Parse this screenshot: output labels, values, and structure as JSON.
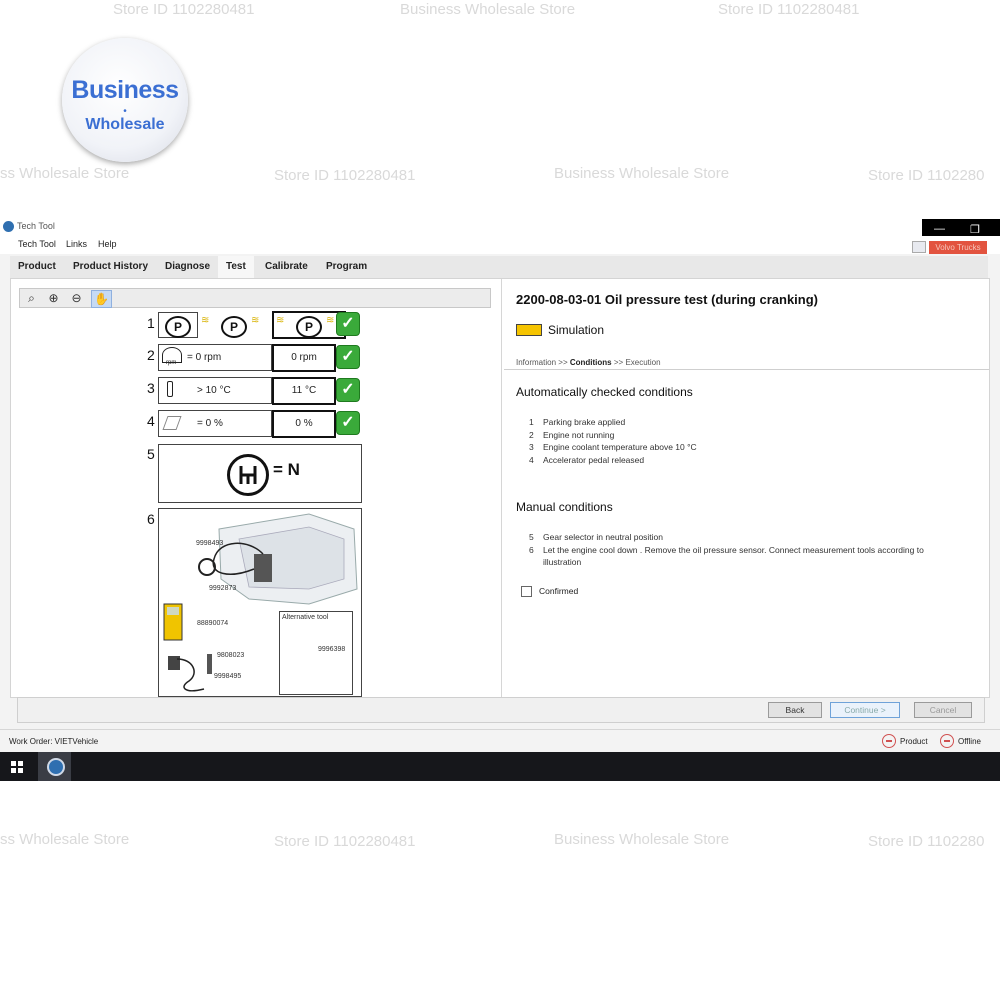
{
  "watermarks": {
    "store_id": "Store ID 1102280481",
    "store_name": "Business Wholesale Store",
    "store_name_cut": "ss Wholesale Store",
    "store_id_cut": "Store ID 1102280"
  },
  "badge": {
    "line1": "Business",
    "dot": "•",
    "line2": "Wholesale"
  },
  "window": {
    "title": "Tech Tool",
    "min_glyph": "—",
    "restore_glyph": "❐",
    "volvo_trucks": "Volvo Trucks"
  },
  "menu": [
    "Tech Tool",
    "Links",
    "Help"
  ],
  "tabs": [
    "Product",
    "Product History",
    "Diagnose",
    "Test",
    "Calibrate",
    "Program"
  ],
  "active_tab": "Test",
  "conditions_panel": {
    "rows": [
      {
        "num": "1",
        "expected": "",
        "actual": ""
      },
      {
        "num": "2",
        "expected": "= 0 rpm",
        "actual": "0 rpm",
        "unit_label": "rpm"
      },
      {
        "num": "3",
        "expected": "> 10 °C",
        "actual": "11 °C"
      },
      {
        "num": "4",
        "expected": "= 0 %",
        "actual": "0 %"
      },
      {
        "num": "5"
      },
      {
        "num": "6"
      }
    ],
    "p_symbol": "P",
    "check_glyph": "✓",
    "gear_equals": "= N",
    "illustration_labels": [
      "9998493",
      "9992873",
      "88890074",
      "9808023",
      "9998495",
      "9996398"
    ],
    "alternative_tool": "Alternative tool"
  },
  "test": {
    "title": "2200-08-03-01 Oil pressure test (during cranking)",
    "mode": "Simulation",
    "breadcrumb": {
      "step1": "Information",
      "sep": ">>",
      "step2": "Conditions",
      "step3": "Execution"
    },
    "auto_heading": "Automatically checked conditions",
    "auto_conditions": [
      {
        "n": "1",
        "text": "Parking brake applied"
      },
      {
        "n": "2",
        "text": "Engine not running"
      },
      {
        "n": "3",
        "text": "Engine coolant temperature above 10 °C"
      },
      {
        "n": "4",
        "text": "Accelerator pedal released"
      }
    ],
    "manual_heading": "Manual conditions",
    "manual_conditions": [
      {
        "n": "5",
        "text": "Gear selector in neutral position"
      },
      {
        "n": "6",
        "text": "Let the engine cool down . Remove the oil pressure sensor. Connect measurement tools according to",
        "text2": "illustration"
      }
    ],
    "confirmed_label": "Confirmed"
  },
  "buttons": {
    "back": "Back",
    "continue": "Continue >",
    "cancel": "Cancel"
  },
  "status": {
    "work_order": "Work Order: VIETVehicle",
    "product": "Product",
    "offline": "Offline"
  }
}
